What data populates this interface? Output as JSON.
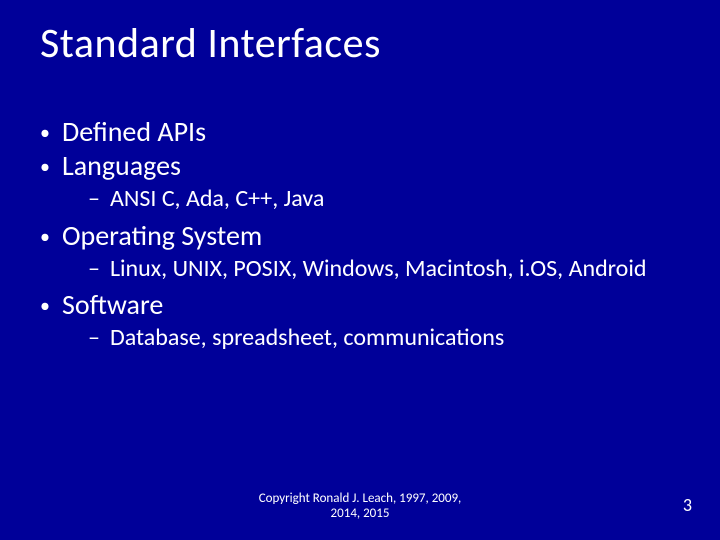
{
  "title": "Standard Interfaces",
  "bullets": [
    {
      "label": "Defined APIs",
      "sub": []
    },
    {
      "label": "Languages",
      "sub": [
        "ANSI C, Ada, C++, Java"
      ]
    },
    {
      "label": "Operating System",
      "sub": [
        "Linux, UNIX, POSIX, Windows, Macintosh, i.OS, Android"
      ]
    },
    {
      "label": "Software",
      "sub": [
        "Database, spreadsheet, communications"
      ]
    }
  ],
  "footer_line1": "Copyright Ronald J. Leach, 1997, 2009,",
  "footer_line2": "2014, 2015",
  "page_number": "3"
}
